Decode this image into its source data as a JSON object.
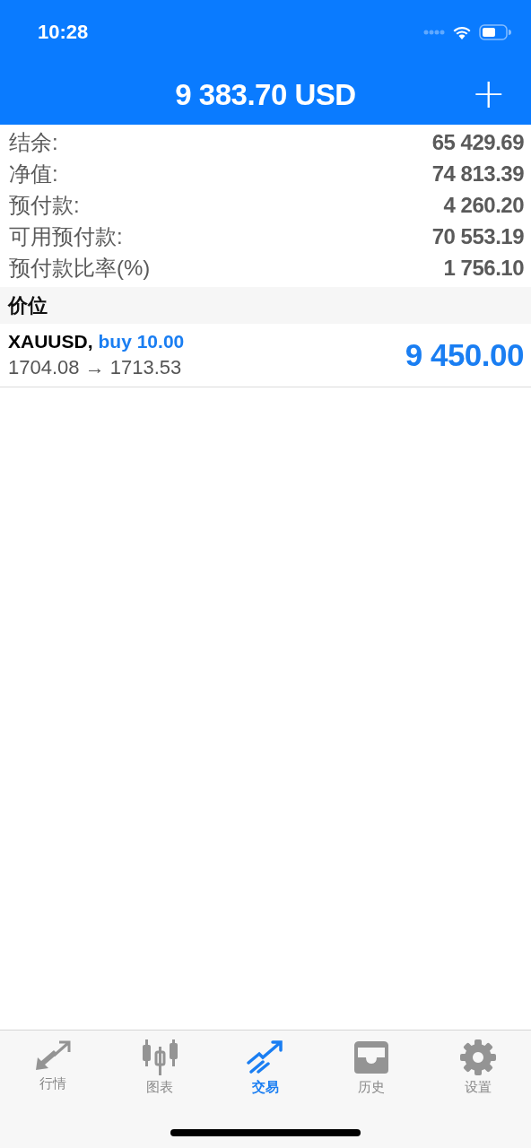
{
  "status_bar": {
    "time": "10:28"
  },
  "header": {
    "title": "9 383.70 USD",
    "action": "+"
  },
  "summary": [
    {
      "label": "结余:",
      "value": "65 429.69"
    },
    {
      "label": "净值:",
      "value": "74 813.39"
    },
    {
      "label": "预付款:",
      "value": "4 260.20"
    },
    {
      "label": "可用预付款:",
      "value": "70 553.19"
    },
    {
      "label": "预付款比率(%)",
      "value": "1 756.10"
    }
  ],
  "section": {
    "title": "价位"
  },
  "positions": [
    {
      "symbol": "XAUUSD,",
      "order": "buy 10.00",
      "prices": "1704.08 → 1713.53",
      "profit": "9 450.00"
    }
  ],
  "tabs": [
    {
      "label": "行情",
      "selected": false
    },
    {
      "label": "图表",
      "selected": false
    },
    {
      "label": "交易",
      "selected": true
    },
    {
      "label": "历史",
      "selected": false
    },
    {
      "label": "设置",
      "selected": false
    }
  ]
}
